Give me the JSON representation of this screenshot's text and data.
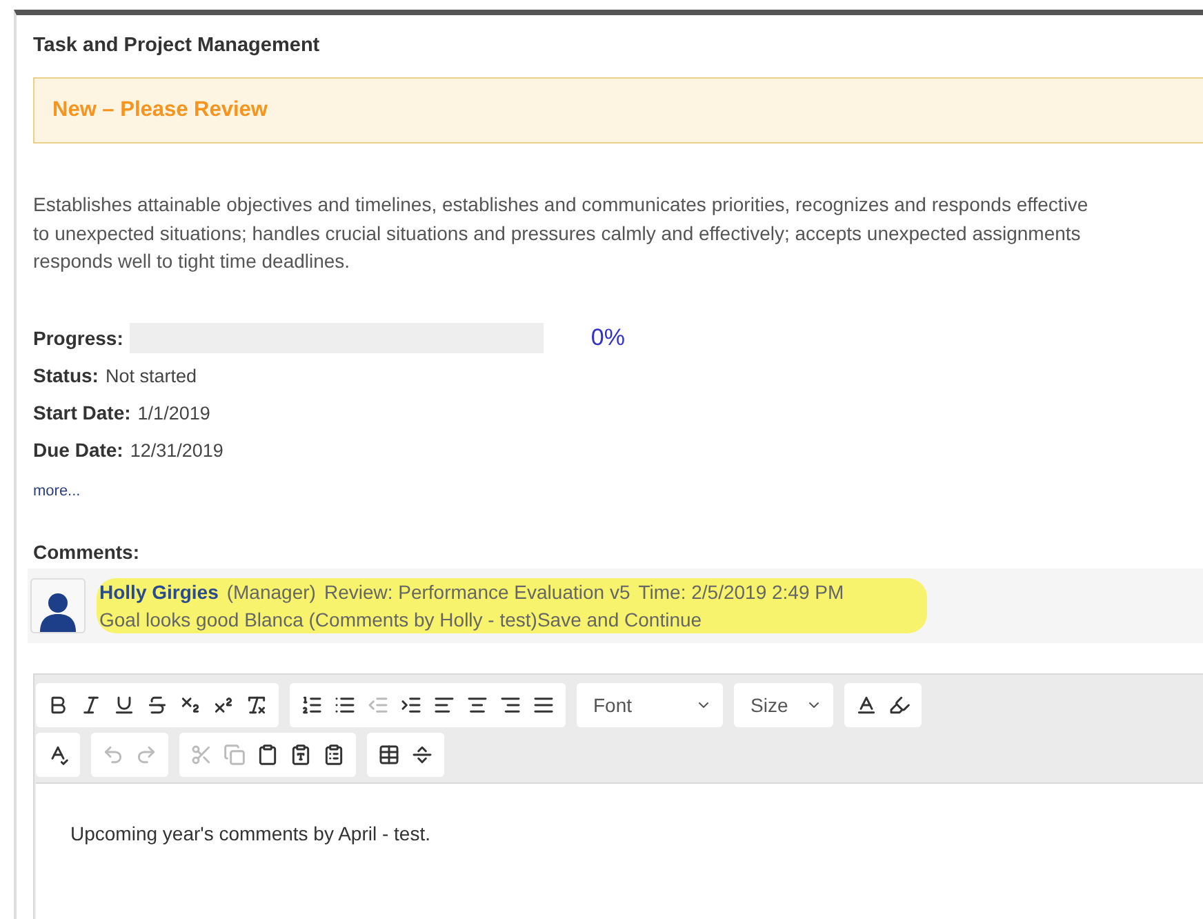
{
  "section": {
    "title": "Task and Project Management"
  },
  "banner": {
    "text": "New – Please Review"
  },
  "description_lines": [
    "Establishes attainable objectives and timelines, establishes and communicates priorities, recognizes and responds effective",
    "to unexpected situations; handles crucial situations and pressures calmly and effectively; accepts unexpected assignments",
    "responds well to tight time deadlines."
  ],
  "progress": {
    "label": "Progress:",
    "level": 0,
    "reading": "0%"
  },
  "fields": [
    {
      "label": "Status:",
      "value": "Not started"
    },
    {
      "label": "Start Date:",
      "value": "1/1/2019"
    },
    {
      "label": "Due Date:",
      "value": "12/31/2019"
    }
  ],
  "more_link": "more...",
  "comments": {
    "label": "Comments:",
    "items": [
      {
        "author": "Holly Girgies",
        "role": "(Manager)",
        "review": "Review: Performance Evaluation v5",
        "time": "Time: 2/5/2019 2:49 PM",
        "text": "Goal looks good Blanca (Comments by Holly - test)Save and Continue",
        "highlighted": true
      }
    ]
  },
  "toolbar": {
    "rows": [
      {
        "groups": [
          {
            "kind": "buttons",
            "buttons": [
              {
                "disabled": false
              },
              {
                "disabled": false
              },
              {
                "disabled": false
              },
              {
                "disabled": false
              },
              {
                "disabled": false
              },
              {
                "disabled": false
              },
              {
                "disabled": false
              }
            ]
          },
          {
            "kind": "buttons",
            "buttons": [
              {
                "disabled": false
              },
              {
                "disabled": false
              },
              {
                "disabled": true
              },
              {
                "disabled": false
              },
              {
                "disabled": false
              },
              {
                "disabled": false
              },
              {
                "disabled": false
              },
              {
                "disabled": false
              }
            ]
          },
          {
            "kind": "dropdown",
            "label": "Font"
          },
          {
            "kind": "dropdown",
            "label": "Size"
          },
          {
            "kind": "buttons",
            "buttons": [
              {
                "disabled": false
              },
              {
                "disabled": false
              }
            ]
          }
        ]
      },
      {
        "groups": [
          {
            "kind": "buttons",
            "buttons": [
              {
                "disabled": false
              }
            ]
          },
          {
            "kind": "buttons",
            "buttons": [
              {
                "disabled": true
              },
              {
                "disabled": true
              }
            ]
          },
          {
            "kind": "buttons",
            "buttons": [
              {
                "disabled": true
              },
              {
                "disabled": true
              },
              {
                "disabled": false
              },
              {
                "disabled": false
              },
              {
                "disabled": false
              }
            ]
          },
          {
            "kind": "buttons",
            "buttons": [
              {
                "disabled": false
              },
              {
                "disabled": false
              }
            ]
          }
        ]
      }
    ]
  },
  "editor": {
    "value": "Upcoming year's comments by April - test."
  }
}
